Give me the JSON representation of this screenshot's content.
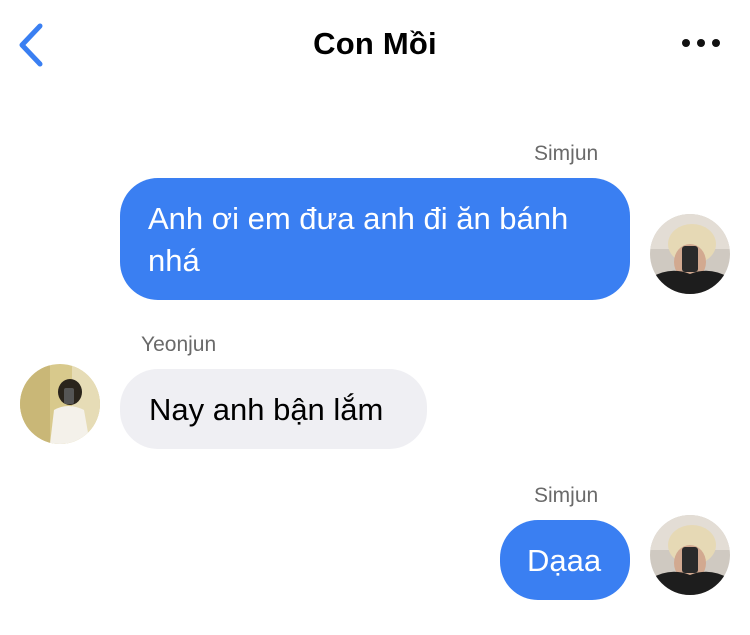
{
  "header": {
    "title": "Con Mồi",
    "back_icon": "chevron-left-icon",
    "more_icon": "ellipsis-icon",
    "accent_color": "#3a7ff2"
  },
  "messages": [
    {
      "sender": "Simjun",
      "text": "Anh ơi em đưa anh đi ăn bánh nhá",
      "direction": "outgoing"
    },
    {
      "sender": "Yeonjun",
      "text": "Nay anh bận lắm",
      "direction": "incoming"
    },
    {
      "sender": "Simjun",
      "text": "Dạaa",
      "direction": "outgoing"
    }
  ],
  "colors": {
    "outgoing_bubble": "#3a7ff2",
    "incoming_bubble": "#efeff3",
    "sender_label": "#6a6a6a"
  }
}
